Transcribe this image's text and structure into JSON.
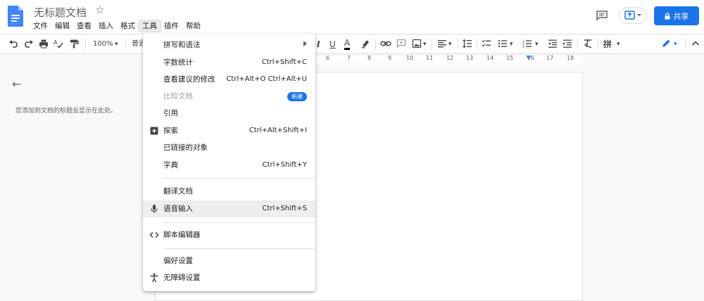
{
  "header": {
    "doc_title": "无标题文档",
    "star_glyph": "☆",
    "share_label": "共享",
    "menu": [
      "文件",
      "编辑",
      "查看",
      "插入",
      "格式",
      "工具",
      "插件",
      "帮助"
    ],
    "active_menu": "工具"
  },
  "toolbar": {
    "zoom": "100%",
    "style_partial": "普通",
    "bold_glyph": "I",
    "underline_glyph": "U",
    "text_color_glyph": "A",
    "input_tools": "拼",
    "dropdown_glyph": "▾"
  },
  "ruler": {
    "labels": [
      "6",
      "7",
      "8",
      "9",
      "10",
      "11",
      "12",
      "13",
      "14",
      "15",
      "16",
      "17",
      "18"
    ]
  },
  "outline": {
    "back_glyph": "←",
    "hint": "您添加到文档的标题会显示在此处。"
  },
  "tools_menu": {
    "items": [
      {
        "label": "拼写和语法",
        "shortcut": ""
      },
      {
        "label": "字数统计",
        "shortcut": "Ctrl+Shift+C"
      },
      {
        "label": "查看建议的修改",
        "shortcut": "Ctrl+Alt+O Ctrl+Alt+U"
      },
      {
        "label": "比较文档",
        "shortcut": "",
        "badge": "新建"
      },
      {
        "label": "引用",
        "shortcut": ""
      },
      {
        "label": "探索",
        "shortcut": "Ctrl+Alt+Shift+I"
      },
      {
        "label": "已链接的对象",
        "shortcut": ""
      },
      {
        "label": "字典",
        "shortcut": "Ctrl+Shift+Y"
      },
      {
        "label": "翻译文档",
        "shortcut": ""
      },
      {
        "label": "语音输入",
        "shortcut": "Ctrl+Shift+S"
      },
      {
        "label": "脚本编辑器",
        "shortcut": ""
      },
      {
        "label": "偏好设置",
        "shortcut": ""
      },
      {
        "label": "无障碍设置",
        "shortcut": ""
      }
    ],
    "icons": {
      "explore": "explore-icon",
      "voice": "microphone-icon",
      "script": "code-icon",
      "a11y": "accessibility-icon"
    }
  },
  "colors": {
    "accent": "#1a73e8",
    "doc_icon": "#4285f4",
    "menu_hover": "#eeeeee"
  }
}
